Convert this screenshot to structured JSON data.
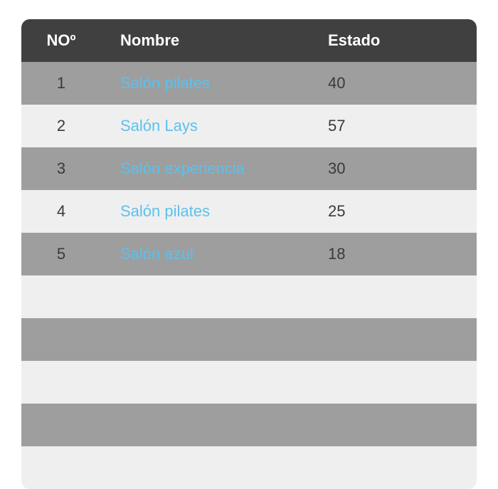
{
  "table": {
    "headers": {
      "no": "NOº",
      "name": "Nombre",
      "state": "Estado"
    },
    "rows": [
      {
        "no": "1",
        "name": "Salón pilates",
        "state": "40"
      },
      {
        "no": "2",
        "name": "Salón Lays",
        "state": "57"
      },
      {
        "no": "3",
        "name": "Salón experiencia",
        "state": "30"
      },
      {
        "no": "4",
        "name": "Salón pilates",
        "state": "25"
      },
      {
        "no": "5",
        "name": "Salón azul",
        "state": "18"
      }
    ]
  },
  "colors": {
    "header_bg": "#404040",
    "row_dark": "#9e9e9e",
    "row_light": "#efefef",
    "link": "#5bc1ee",
    "text": "#3a3a3a"
  }
}
